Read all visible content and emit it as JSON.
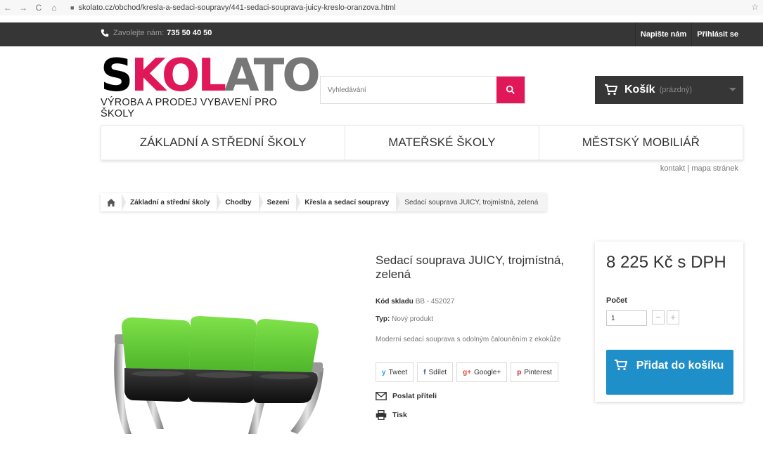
{
  "browser": {
    "url": "skolato.cz/obchod/kresla-a-sedaci-soupravy/441-sedaci-souprava-juicy-kreslo-oranzova.html",
    "back": "←",
    "forward": "→",
    "reload": "C",
    "home": "⌂",
    "star": "☆"
  },
  "topbar": {
    "phone_label": "Zavolejte nám:",
    "phone_number": "735 50 40 50",
    "links": [
      "Napište nám",
      "Přihlásit se"
    ]
  },
  "logo": {
    "text_s": "S",
    "text_k": "K",
    "text_o": "O",
    "text_l": "L",
    "text_ato": "ATO",
    "subtitle": "VÝROBA A PRODEJ VYBAVENÍ PRO ŠKOLY"
  },
  "search": {
    "placeholder": "Vyhledávání"
  },
  "cart": {
    "title": "Košík",
    "status": "(prázdný)"
  },
  "menu": [
    "ZÁKLADNÍ A STŘEDNÍ ŠKOLY",
    "MATEŘSKÉ ŠKOLY",
    "MĚSTSKÝ MOBILIÁŘ"
  ],
  "sublinks": {
    "contact": "kontakt",
    "sep": "|",
    "sitemap": "mapa stránek"
  },
  "breadcrumb": [
    "Základní a střední školy",
    "Chodby",
    "Sezení",
    "Křesla a sedací soupravy",
    "Sedací souprava JUICY, trojmístná, zelená"
  ],
  "product": {
    "title": "Sedací souprava JUICY, trojmístná, zelená",
    "sku_label": "Kód skladu",
    "sku_value": "BB - 452027",
    "type_label": "Typ:",
    "type_value": "Nový produkt",
    "description": "Moderní sedací souprava s odolným čalouněním z ekokůže",
    "social": [
      {
        "icon": "y",
        "label": "Tweet"
      },
      {
        "icon": "f",
        "label": "Sdílet"
      },
      {
        "icon": "g+",
        "label": "Google+"
      },
      {
        "icon": "p",
        "label": "Pinterest"
      }
    ],
    "send_friend": "Poslat příteli",
    "print": "Tisk"
  },
  "buybox": {
    "price": "8 225 Kč s DPH",
    "qty_label": "Počet",
    "qty_value": "1",
    "minus": "−",
    "plus": "+",
    "add_label": "Přidat do košíku"
  },
  "colors": {
    "brand": "#e0185a",
    "dark": "#363636",
    "button_blue": "#1f8fc9",
    "seat_green": "#6bd33f"
  }
}
